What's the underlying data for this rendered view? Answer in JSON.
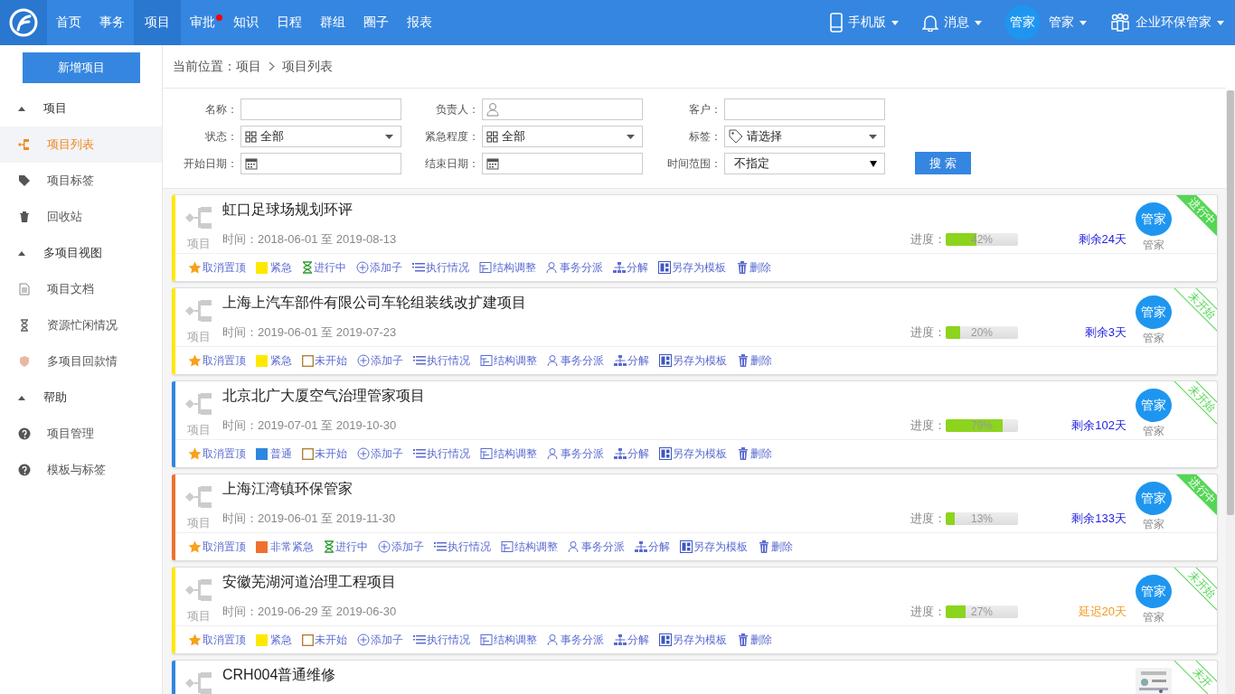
{
  "nav": {
    "items": [
      {
        "label": "首页",
        "selected": false,
        "dot": false
      },
      {
        "label": "事务",
        "selected": false,
        "dot": false
      },
      {
        "label": "项目",
        "selected": true,
        "dot": false
      },
      {
        "label": "审批",
        "selected": false,
        "dot": true
      },
      {
        "label": "知识",
        "selected": false,
        "dot": false
      },
      {
        "label": "日程",
        "selected": false,
        "dot": false
      },
      {
        "label": "群组",
        "selected": false,
        "dot": false
      },
      {
        "label": "圈子",
        "selected": false,
        "dot": false
      },
      {
        "label": "报表",
        "selected": false,
        "dot": false
      }
    ],
    "right": [
      {
        "kind": "phone",
        "label": "手机版"
      },
      {
        "kind": "bell",
        "label": "消息"
      },
      {
        "kind": "user",
        "avatar": "管家",
        "label": "管家"
      },
      {
        "kind": "org",
        "label": "企业环保管家"
      }
    ]
  },
  "sidebar": {
    "button": "新增项目",
    "groups": [
      {
        "label": "项目",
        "expanded": true,
        "children": [
          {
            "label": "项目列表",
            "kind": "tree",
            "selected": true
          },
          {
            "label": "项目标签",
            "kind": "tag",
            "selected": false
          },
          {
            "label": "回收站",
            "kind": "trash",
            "selected": false
          }
        ]
      },
      {
        "label": "多项目视图",
        "expanded": true,
        "children": [
          {
            "label": "项目文档",
            "kind": "doc",
            "selected": false
          },
          {
            "label": "资源忙闲情况",
            "kind": "hourglass",
            "selected": false
          },
          {
            "label": "多项目回款情",
            "kind": "shield",
            "selected": false
          }
        ]
      },
      {
        "label": "帮助",
        "expanded": true,
        "children": [
          {
            "label": "项目管理",
            "kind": "help",
            "selected": false
          },
          {
            "label": "模板与标签",
            "kind": "help",
            "selected": false
          }
        ]
      }
    ]
  },
  "breadcrumb": [
    "当前位置：项目",
    "项目列表"
  ],
  "filters": {
    "fields": [
      {
        "label": "名称：",
        "kind": "text"
      },
      {
        "label": "负责人：",
        "kind": "person"
      },
      {
        "label": "客户：",
        "kind": "text"
      },
      {
        "label": "状态：",
        "kind": "grid-select",
        "value": "全部"
      },
      {
        "label": "紧急程度：",
        "kind": "grid-select",
        "value": "全部"
      },
      {
        "label": "标签：",
        "kind": "tag-select",
        "value": "请选择"
      },
      {
        "label": "开始日期：",
        "kind": "date"
      },
      {
        "label": "结束日期：",
        "kind": "date"
      },
      {
        "label": "时间范围：",
        "kind": "native-select",
        "value": "不指定"
      }
    ],
    "search_button": "搜 索"
  },
  "projects": [
    {
      "name": "虹口足球场规划环评",
      "type_label": "项目",
      "time": "时间：2018-06-01 至 2019-08-13",
      "progress_label": "进度：",
      "level": 0.42,
      "progress_text": "42%",
      "remaining": {
        "text": "剩余24天",
        "kind": "remaining"
      },
      "owner": {
        "avatar": "管家",
        "caption": "管家"
      },
      "ribbon": {
        "text": "进行中",
        "kind": "in_progress"
      },
      "pin": "取消置顶",
      "urgency": {
        "label": "紧急",
        "color": "#ffe800"
      },
      "status": {
        "label": "进行中",
        "kind": "in_progress"
      },
      "actions": [
        {
          "label": "添加子",
          "kind": "add"
        },
        {
          "label": "执行情况",
          "kind": "list"
        },
        {
          "label": "结构调整",
          "kind": "structure"
        },
        {
          "label": "事务分派",
          "kind": "person"
        },
        {
          "label": "分解",
          "kind": "split"
        },
        {
          "label": "另存为模板",
          "kind": "template"
        },
        {
          "label": "删除",
          "kind": "delete"
        }
      ]
    },
    {
      "name": "上海上汽车部件有限公司车轮组装线改扩建项目",
      "type_label": "项目",
      "time": "时间：2019-06-01 至 2019-07-23",
      "progress_label": "进度：",
      "level": 0.2,
      "progress_text": "20%",
      "remaining": {
        "text": "剩余3天",
        "kind": "remaining"
      },
      "owner": {
        "avatar": "管家",
        "caption": "管家"
      },
      "ribbon": {
        "text": "未开始",
        "kind": "not_started"
      },
      "pin": "取消置顶",
      "urgency": {
        "label": "紧急",
        "color": "#ffe800"
      },
      "status": {
        "label": "未开始",
        "kind": "not_started"
      },
      "actions": [
        {
          "label": "添加子",
          "kind": "add"
        },
        {
          "label": "执行情况",
          "kind": "list"
        },
        {
          "label": "结构调整",
          "kind": "structure"
        },
        {
          "label": "事务分派",
          "kind": "person"
        },
        {
          "label": "分解",
          "kind": "split"
        },
        {
          "label": "另存为模板",
          "kind": "template"
        },
        {
          "label": "删除",
          "kind": "delete"
        }
      ]
    },
    {
      "name": "北京北广大厦空气治理管家项目",
      "type_label": "项目",
      "time": "时间：2019-07-01 至 2019-10-30",
      "progress_label": "进度：",
      "level": 0.79,
      "progress_text": "79%",
      "remaining": {
        "text": "剩余102天",
        "kind": "remaining"
      },
      "owner": {
        "avatar": "管家",
        "caption": "管家"
      },
      "ribbon": {
        "text": "未开始",
        "kind": "not_started"
      },
      "pin": "取消置顶",
      "urgency": {
        "label": "普通",
        "color": "#2f86e0"
      },
      "status": {
        "label": "未开始",
        "kind": "not_started"
      },
      "actions": [
        {
          "label": "添加子",
          "kind": "add"
        },
        {
          "label": "执行情况",
          "kind": "list"
        },
        {
          "label": "结构调整",
          "kind": "structure"
        },
        {
          "label": "事务分派",
          "kind": "person"
        },
        {
          "label": "分解",
          "kind": "split"
        },
        {
          "label": "另存为模板",
          "kind": "template"
        },
        {
          "label": "删除",
          "kind": "delete"
        }
      ]
    },
    {
      "name": "上海江湾镇环保管家",
      "type_label": "项目",
      "time": "时间：2019-06-01 至 2019-11-30",
      "progress_label": "进度：",
      "level": 0.13,
      "progress_text": "13%",
      "remaining": {
        "text": "剩余133天",
        "kind": "remaining"
      },
      "owner": {
        "avatar": "管家",
        "caption": "管家"
      },
      "ribbon": {
        "text": "进行中",
        "kind": "in_progress"
      },
      "pin": "取消置顶",
      "urgency": {
        "label": "非常紧急",
        "color": "#f07030"
      },
      "status": {
        "label": "进行中",
        "kind": "in_progress"
      },
      "actions": [
        {
          "label": "添加子",
          "kind": "add"
        },
        {
          "label": "执行情况",
          "kind": "list"
        },
        {
          "label": "结构调整",
          "kind": "structure"
        },
        {
          "label": "事务分派",
          "kind": "person"
        },
        {
          "label": "分解",
          "kind": "split"
        },
        {
          "label": "另存为模板",
          "kind": "template"
        },
        {
          "label": "删除",
          "kind": "delete"
        }
      ]
    },
    {
      "name": "安徽芜湖河道治理工程项目",
      "type_label": "项目",
      "time": "时间：2019-06-29 至 2019-06-30",
      "progress_label": "进度：",
      "level": 0.27,
      "progress_text": "27%",
      "remaining": {
        "text": "延迟20天",
        "kind": "overdue"
      },
      "owner": {
        "avatar": "管家",
        "caption": "管家"
      },
      "ribbon": {
        "text": "未开始",
        "kind": "not_started"
      },
      "pin": "取消置顶",
      "urgency": {
        "label": "紧急",
        "color": "#ffe800"
      },
      "status": {
        "label": "未开始",
        "kind": "not_started"
      },
      "actions": [
        {
          "label": "添加子",
          "kind": "add"
        },
        {
          "label": "执行情况",
          "kind": "list"
        },
        {
          "label": "结构调整",
          "kind": "structure"
        },
        {
          "label": "事务分派",
          "kind": "person"
        },
        {
          "label": "分解",
          "kind": "split"
        },
        {
          "label": "另存为模板",
          "kind": "template"
        },
        {
          "label": "删除",
          "kind": "delete"
        }
      ]
    },
    {
      "name": "CRH004普通维修",
      "urgency": {
        "color": "#2f86e0"
      },
      "ribbon": {
        "text": "未开",
        "kind": "not_started"
      }
    }
  ]
}
